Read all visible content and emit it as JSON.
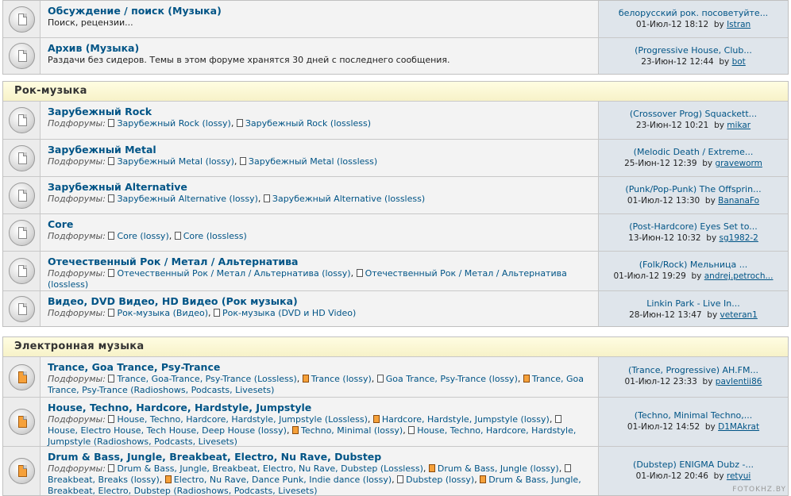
{
  "top_forums": [
    {
      "title": "Обсуждение / поиск (Музыка)",
      "desc": "Поиск, рецензии...",
      "last_topic": "белорусский рок. посоветуйте...",
      "last_date": "01-Июл-12 18:12",
      "last_by": "by",
      "last_user": "Istran"
    },
    {
      "title": "Архив (Музыка)",
      "desc": "Раздачи без сидеров. Темы в этом форуме хранятся 30 дней с последнего сообщения.",
      "last_topic": "(Progressive House, Club...",
      "last_date": "23-Июн-12 12:44",
      "last_by": "by",
      "last_user": "bot"
    }
  ],
  "subforums_prefix": "Подфорумы:",
  "rock": {
    "title": "Рок-музыка",
    "forums": [
      {
        "title": "Зарубежный Rock",
        "subs": [
          "Зарубежный Rock (lossy)",
          "Зарубежный Rock (lossless)"
        ],
        "last_topic": "(Crossover Prog) Squackett...",
        "last_date": "23-Июн-12 10:21",
        "last_by": "by",
        "last_user": "mikar"
      },
      {
        "title": "Зарубежный Metal",
        "subs": [
          "Зарубежный Metal (lossy)",
          "Зарубежный Metal (lossless)"
        ],
        "last_topic": "(Melodic Death / Extreme...",
        "last_date": "25-Июн-12 12:39",
        "last_by": "by",
        "last_user": "graveworm"
      },
      {
        "title": "Зарубежный Alternative",
        "subs": [
          "Зарубежный Alternative (lossy)",
          "Зарубежный Alternative (lossless)"
        ],
        "last_topic": "(Punk/Pop-Punk) The Offsprin...",
        "last_date": "01-Июл-12 13:30",
        "last_by": "by",
        "last_user": "BananaFo"
      },
      {
        "title": "Core",
        "subs": [
          "Core (lossy)",
          "Core (lossless)"
        ],
        "last_topic": "(Post-Hardcore) Eyes Set to...",
        "last_date": "13-Июн-12 10:32",
        "last_by": "by",
        "last_user": "sg1982-2"
      },
      {
        "title": "Отечественный Рок / Метал / Альтернатива",
        "subs": [
          "Отечественный Рок / Метал / Альтернатива (lossy)",
          "Отечественный Рок / Метал / Альтернатива (lossless)"
        ],
        "last_topic": "(Folk/Rock) Мельница ...",
        "last_date": "01-Июл-12 19:29",
        "last_by": "by",
        "last_user": "andrej.petroch..."
      },
      {
        "title": "Видео, DVD Видео, HD Видео (Рок музыка)",
        "subs": [
          "Рок-музыка (Видео)",
          "Рок-музыка (DVD и HD Video)"
        ],
        "last_topic": "Linkin Park - Live In...",
        "last_date": "28-Июн-12 13:47",
        "last_by": "by",
        "last_user": "veteran1"
      }
    ]
  },
  "electronic": {
    "title": "Электронная музыка",
    "forums": [
      {
        "title": "Trance, Goa Trance, Psy-Trance",
        "subs": [
          "Trance, Goa-Trance, Psy-Trance (Lossless)",
          "Trance (lossy)",
          "Goa Trance, Psy-Trance (lossy)",
          "Trance, Goa Trance, Psy-Trance (Radioshows, Podcasts, Livesets)"
        ],
        "last_topic": "(Trance, Progressive) AH.FM...",
        "last_date": "01-Июл-12 23:33",
        "last_by": "by",
        "last_user": "pavlentii86"
      },
      {
        "title": "House, Techno, Hardcore, Hardstyle, Jumpstyle",
        "subs": [
          "House, Techno, Hardcore, Hardstyle, Jumpstyle (Lossless)",
          "Hardcore, Hardstyle, Jumpstyle (lossy)",
          "House, Electro House, Tech House, Deep House (lossy)",
          "Techno, Minimal (lossy)",
          "House, Techno, Hardcore, Hardstyle, Jumpstyle (Radioshows, Podcasts, Livesets)"
        ],
        "last_topic": "(Techno, Minimal Techno,...",
        "last_date": "01-Июл-12 14:52",
        "last_by": "by",
        "last_user": "D1MAkrat"
      },
      {
        "title": "Drum & Bass, Jungle, Breakbeat, Electro, Nu Rave, Dubstep",
        "subs": [
          "Drum & Bass, Jungle, Breakbeat, Electro, Nu Rave, Dubstep (Lossless)",
          "Drum & Bass, Jungle (lossy)",
          "Breakbeat, Breaks (lossy)",
          "Electro, Nu Rave, Dance Punk, Indie dance (lossy)",
          "Dubstep (lossy)",
          "Drum & Bass, Jungle, Breakbeat, Electro, Dubstep (Radioshows, Podcasts, Livesets)"
        ],
        "last_topic": "(Dubstep) ENIGMA Dubz -...",
        "last_date": "01-Июл-12 20:46",
        "last_by": "by",
        "last_user": "retyui"
      }
    ]
  },
  "watermark": "FOTOKHZ.BY"
}
